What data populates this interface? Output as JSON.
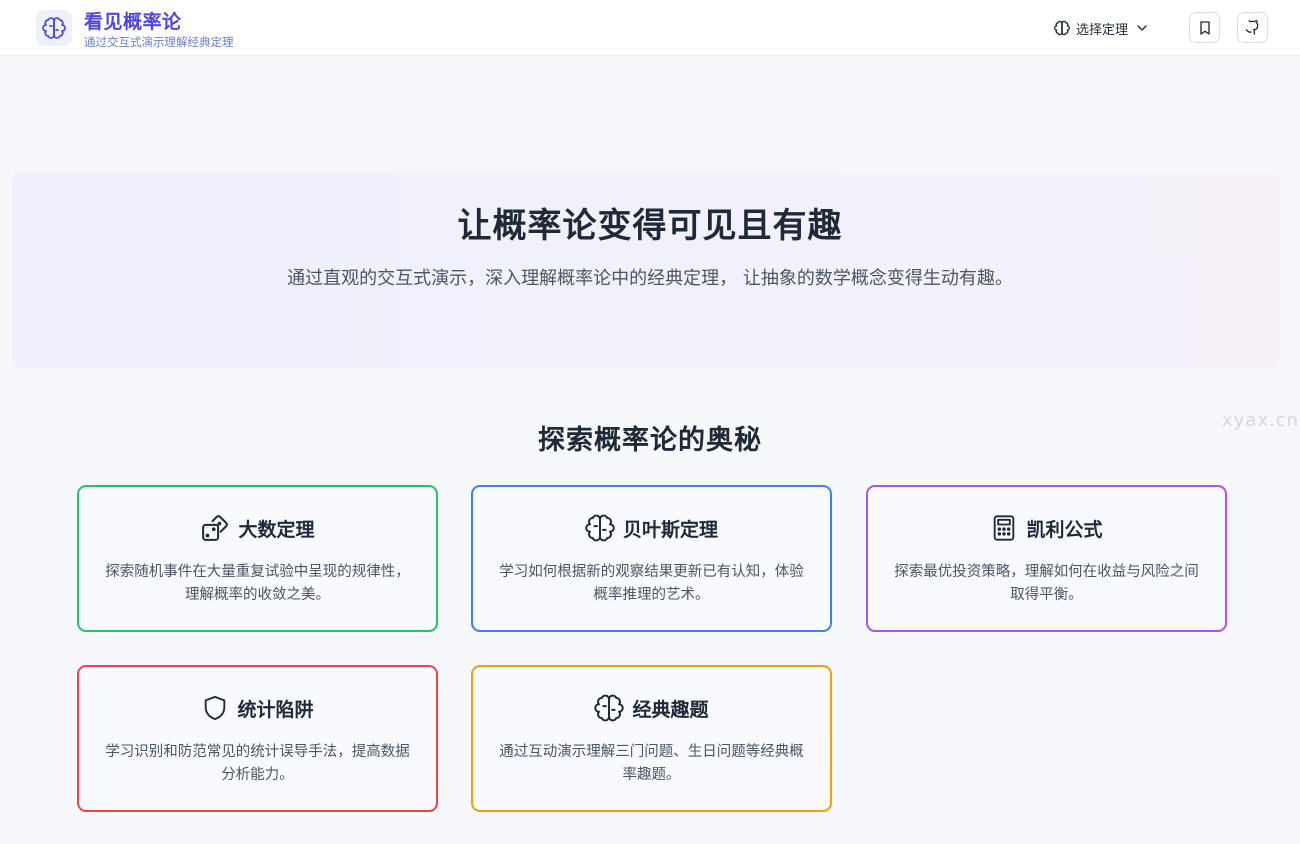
{
  "header": {
    "logo_icon": "brain-icon",
    "title": "看见概率论",
    "subtitle": "通过交互式演示理解经典定理",
    "theorem_select_label": "选择定理",
    "bookmark_icon": "bookmark-icon",
    "github_icon": "github-icon"
  },
  "hero": {
    "title": "让概率论变得可见且有趣",
    "description": "通过直观的交互式演示，深入理解概率论中的经典定理， 让抽象的数学概念变得生动有趣。"
  },
  "section": {
    "title": "探索概率论的奥秘"
  },
  "cards": [
    {
      "title": "大数定理",
      "description": "探索随机事件在大量重复试验中呈现的规律性，理解概率的收敛之美。",
      "icon": "dice-icon",
      "border_color": "#22c55e"
    },
    {
      "title": "贝叶斯定理",
      "description": "学习如何根据新的观察结果更新已有认知，体验概率推理的艺术。",
      "icon": "brain-icon",
      "border_color": "#3b82f6"
    },
    {
      "title": "凯利公式",
      "description": "探索最优投资策略，理解如何在收益与风险之间取得平衡。",
      "icon": "calculator-icon",
      "border_color": "#a855f7"
    },
    {
      "title": "统计陷阱",
      "description": "学习识别和防范常见的统计误导手法，提高数据分析能力。",
      "icon": "shield-icon",
      "border_color": "#ef4444"
    },
    {
      "title": "经典趣题",
      "description": "通过互动演示理解三门问题、生日问题等经典概率趣题。",
      "icon": "brain-icon",
      "border_color": "#f59e0b"
    }
  ],
  "watermark": "xyax.cn"
}
